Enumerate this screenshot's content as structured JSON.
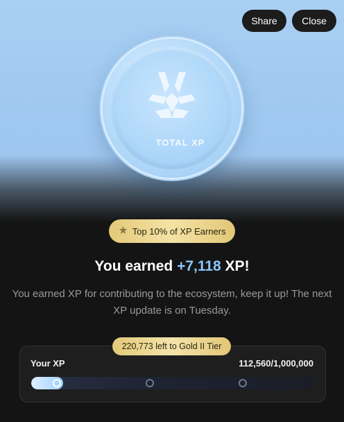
{
  "header": {
    "share_label": "Share",
    "close_label": "Close"
  },
  "coin": {
    "label": "TOTAL XP",
    "icon": "xp-logo-icon"
  },
  "badge": {
    "icon": "star-icon",
    "label": "Top 10% of XP Earners"
  },
  "headline": {
    "prefix": "You earned ",
    "amount": "+7,118",
    "suffix": " XP!"
  },
  "description": "You earned XP for contributing to the ecosystem, keep it up! The next XP update is on Tuesday.",
  "progress": {
    "tier_note": "220,773 left to Gold II Tier",
    "label": "Your XP",
    "count_text": "112,560/1,000,000",
    "fraction": 0.11256,
    "milestones": [
      0.09,
      0.42,
      0.75
    ]
  },
  "colors": {
    "accent": "#8cc6ff",
    "gold": "#f4e3a6",
    "background": "#141414"
  }
}
